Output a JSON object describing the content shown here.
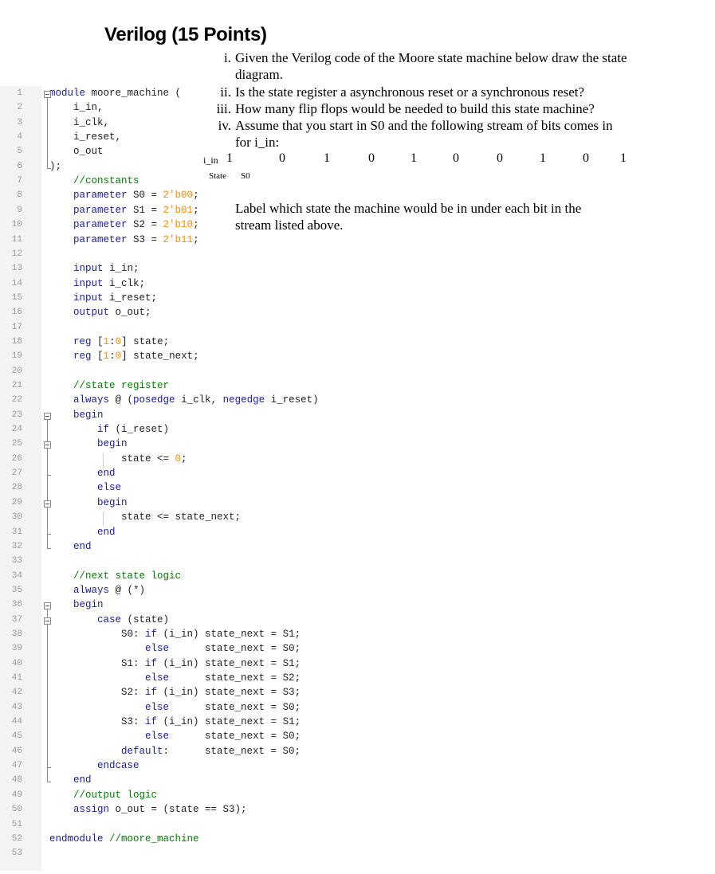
{
  "title": "Verilog (15 Points)",
  "questions": [
    {
      "num": "i.",
      "text": "Given the Verilog code of the Moore state machine below draw the state diagram."
    },
    {
      "num": "ii.",
      "text": "Is the state register a asynchronous reset or a synchronous reset?"
    },
    {
      "num": "iii.",
      "text": "How many flip flops would be needed to build this state machine?"
    },
    {
      "num": "iv.",
      "text": "Assume that you start in S0 and the following stream of bits comes in for i_in:"
    }
  ],
  "stream": {
    "label": "i_in",
    "bits": [
      "1",
      "0",
      "1",
      "0",
      "1",
      "0",
      "0",
      "1",
      "0",
      "1"
    ],
    "state_label": "State",
    "state_start": "S0"
  },
  "label_instruction": "Label which state the machine would be in under each bit in the stream listed above.",
  "code_lines": [
    "module moore_machine (",
    "    i_in,",
    "    i_clk,",
    "    i_reset,",
    "    o_out",
    ");",
    "    //constants",
    "    parameter S0 = 2'b00;",
    "    parameter S1 = 2'b01;",
    "    parameter S2 = 2'b10;",
    "    parameter S3 = 2'b11;",
    "",
    "    input i_in;",
    "    input i_clk;",
    "    input i_reset;",
    "    output o_out;",
    "",
    "    reg [1:0] state;",
    "    reg [1:0] state_next;",
    "",
    "    //state register",
    "    always @ (posedge i_clk, negedge i_reset)",
    "    begin",
    "        if (i_reset)",
    "        begin",
    "            state <= 0;",
    "        end",
    "        else",
    "        begin",
    "            state <= state_next;",
    "        end",
    "    end",
    "",
    "    //next state logic",
    "    always @ (*)",
    "    begin",
    "        case (state)",
    "            S0: if (i_in) state_next = S1;",
    "                else      state_next = S0;",
    "            S1: if (i_in) state_next = S1;",
    "                else      state_next = S2;",
    "            S2: if (i_in) state_next = S3;",
    "                else      state_next = S0;",
    "            S3: if (i_in) state_next = S1;",
    "                else      state_next = S0;",
    "            default:      state_next = S0;",
    "        endcase",
    "    end",
    "    //output logic",
    "    assign o_out = (state == S3);",
    "",
    "endmodule //moore_machine",
    ""
  ]
}
